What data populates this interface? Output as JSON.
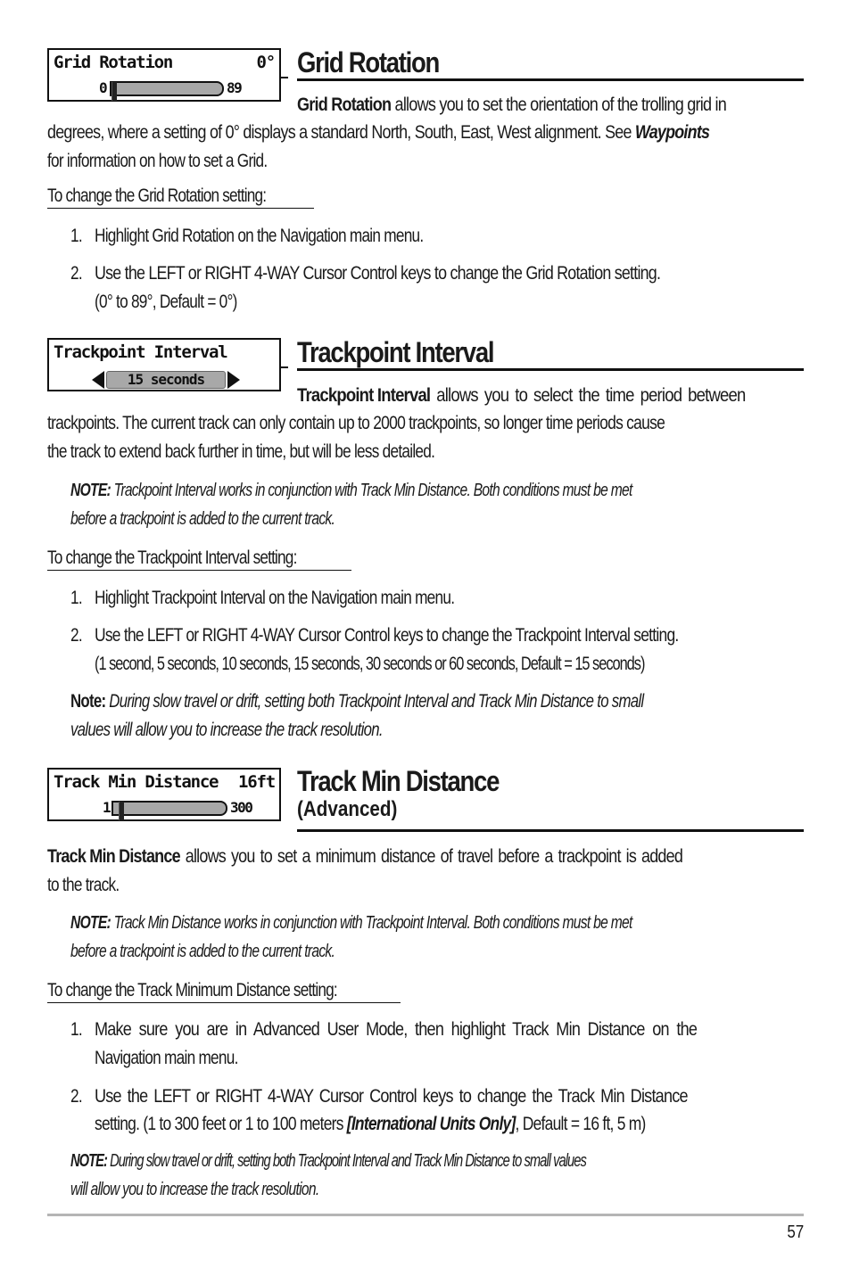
{
  "sections": {
    "grid_rotation": {
      "widget": {
        "label": "Grid Rotation",
        "value": "0°",
        "min": "0",
        "max": "89",
        "slider_fraction": 0.0
      },
      "heading": "Grid Rotation",
      "intro_bold": "Grid Rotation",
      "intro_line1_rest": " allows you to set the orientation of the trolling grid in",
      "intro_line2_pre": "degrees, where a setting of 0° displays a standard North, South, East, West alignment. See ",
      "intro_line2_link": "Waypoints",
      "intro_line3": "for information on how to set a Grid.",
      "procedure_title": "To change the Grid Rotation setting:",
      "steps": [
        {
          "num": "1.",
          "text": "Highlight Grid Rotation on the Navigation main menu."
        },
        {
          "num": "2.",
          "line1": "Use the LEFT or RIGHT 4-WAY Cursor Control keys to change the Grid Rotation setting.",
          "line2": "(0° to 89°, Default = 0°)"
        }
      ]
    },
    "trackpoint_interval": {
      "widget": {
        "label": "Trackpoint Interval",
        "selected": "15 seconds"
      },
      "heading": "Trackpoint Interval",
      "intro_bold": "Trackpoint Interval",
      "intro_line1_rest": " allows you to select the time period between",
      "intro_line2": "trackpoints.  The current track can only contain up to 2000 trackpoints, so longer time periods cause",
      "intro_line3": "the track to extend back further in time, but will be less detailed.",
      "note1_label": "NOTE:",
      "note1_line1": " Trackpoint Interval works in conjunction with Track Min Distance.  Both conditions must be met",
      "note1_line2": "before a trackpoint is added to the current track.",
      "procedure_title": "To change the Trackpoint Interval setting:",
      "steps": [
        {
          "num": "1.",
          "text": "Highlight Trackpoint Interval on the Navigation main menu."
        },
        {
          "num": "2.",
          "line1": "Use the LEFT or RIGHT 4-WAY Cursor Control keys to change the Trackpoint Interval setting.",
          "line2": "(1 second, 5 seconds, 10 seconds, 15 seconds, 30 seconds or 60 seconds, Default = 15 seconds)"
        }
      ],
      "note2_label": "Note:",
      "note2_line1": " During slow travel or drift, setting both Trackpoint Interval and Track Min Distance to small",
      "note2_line2": "values will allow you to increase the track resolution."
    },
    "track_min_distance": {
      "widget": {
        "label": "Track Min Distance",
        "value": "16ft",
        "min": "1",
        "max": "300",
        "slider_fraction": 0.05
      },
      "heading": "Track Min Distance",
      "subheading": "(Advanced)",
      "intro_bold": "Track Min Distance",
      "intro_line1_rest": " allows you to set a minimum distance of travel before a trackpoint is added",
      "intro_line2": "to the track.",
      "note1_label": "NOTE:",
      "note1_line1": " Track Min Distance works in conjunction with Trackpoint Interval.  Both conditions must be met",
      "note1_line2": "before a trackpoint is added to the current track.",
      "procedure_title": "To change the Track Minimum Distance setting:",
      "steps": [
        {
          "num": "1.",
          "line1": "Make sure you are in Advanced User Mode, then highlight Track Min Distance on the",
          "line2": "Navigation main menu."
        },
        {
          "num": "2.",
          "line1": "Use the LEFT or RIGHT 4-WAY Cursor Control keys to change the Track Min Distance",
          "line2_pre": "setting. (1 to 300 feet or 1 to 100 meters ",
          "line2_em": "[International Units Only]",
          "line2_post": ", Default = 16 ft, 5 m)"
        }
      ],
      "note2_label": "NOTE:",
      "note2_line1": " During slow travel or drift, setting both Trackpoint Interval and Track Min Distance to small values",
      "note2_line2": "will allow you to increase the track resolution."
    }
  },
  "footer": {
    "page_number": "57"
  }
}
